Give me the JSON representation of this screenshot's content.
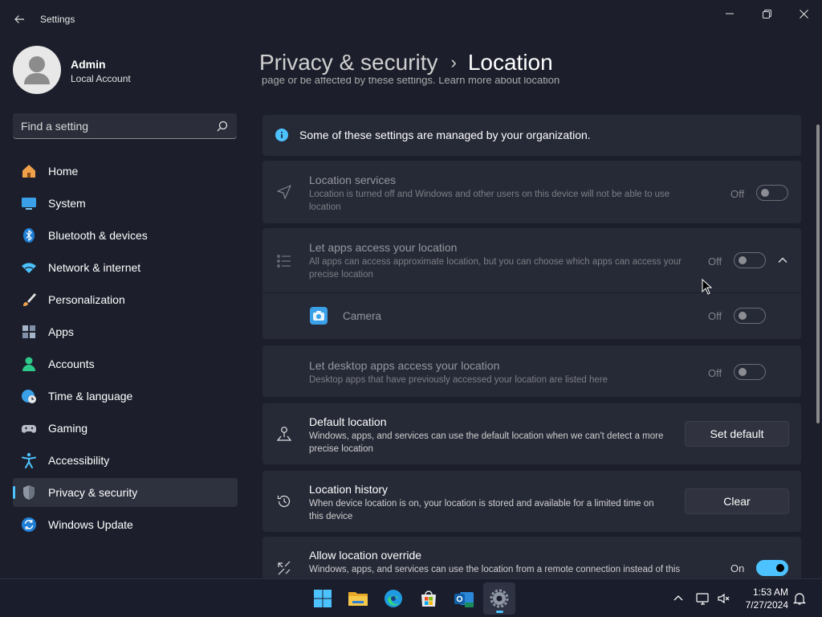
{
  "window": {
    "title": "Settings"
  },
  "user": {
    "name": "Admin",
    "account_type": "Local Account"
  },
  "search": {
    "placeholder": "Find a setting"
  },
  "sidebar": {
    "items": [
      {
        "label": "Home",
        "icon": "home-icon"
      },
      {
        "label": "System",
        "icon": "monitor-icon"
      },
      {
        "label": "Bluetooth & devices",
        "icon": "bluetooth-icon"
      },
      {
        "label": "Network & internet",
        "icon": "wifi-icon"
      },
      {
        "label": "Personalization",
        "icon": "brush-icon"
      },
      {
        "label": "Apps",
        "icon": "apps-icon"
      },
      {
        "label": "Accounts",
        "icon": "person-icon"
      },
      {
        "label": "Time & language",
        "icon": "globe-clock-icon"
      },
      {
        "label": "Gaming",
        "icon": "controller-icon"
      },
      {
        "label": "Accessibility",
        "icon": "accessibility-icon"
      },
      {
        "label": "Privacy & security",
        "icon": "shield-icon",
        "active": true
      },
      {
        "label": "Windows Update",
        "icon": "update-icon"
      }
    ]
  },
  "breadcrumb": {
    "parent": "Privacy & security",
    "separator": "›",
    "current": "Location"
  },
  "page": {
    "clipped_text": "page or be affected by these settings. Learn more about location",
    "org_notice": "Some of these settings are managed by your organization.",
    "location_services": {
      "title": "Location services",
      "description": "Location is turned off and Windows and other users on this device will not be able to use location",
      "state": "Off"
    },
    "apps_access": {
      "title": "Let apps access your location",
      "description": "All apps can access approximate location, but you can choose which apps can access your precise location",
      "state": "Off"
    },
    "camera": {
      "label": "Camera",
      "state": "Off"
    },
    "desktop_apps": {
      "title": "Let desktop apps access your location",
      "description": "Desktop apps that have previously accessed your location are listed here",
      "state": "Off"
    },
    "default_location": {
      "title": "Default location",
      "description": "Windows, apps, and services can use the default location when we can't detect a more precise location",
      "button": "Set default"
    },
    "location_history": {
      "title": "Location history",
      "description": "When device location is on, your location is stored and available for a limited time on this device",
      "button": "Clear"
    },
    "location_override": {
      "title": "Allow location override",
      "description": "Windows, apps, and services can use the location from a remote connection instead of this",
      "state": "On"
    }
  },
  "taskbar": {
    "apps": [
      "start-icon",
      "file-explorer-icon",
      "edge-icon",
      "store-icon",
      "outlook-icon",
      "settings-icon"
    ],
    "time": "1:53 AM",
    "date": "7/27/2024"
  },
  "colors": {
    "accent": "#4cc2ff",
    "background": "#1c1f2b",
    "card": "#262a37"
  }
}
